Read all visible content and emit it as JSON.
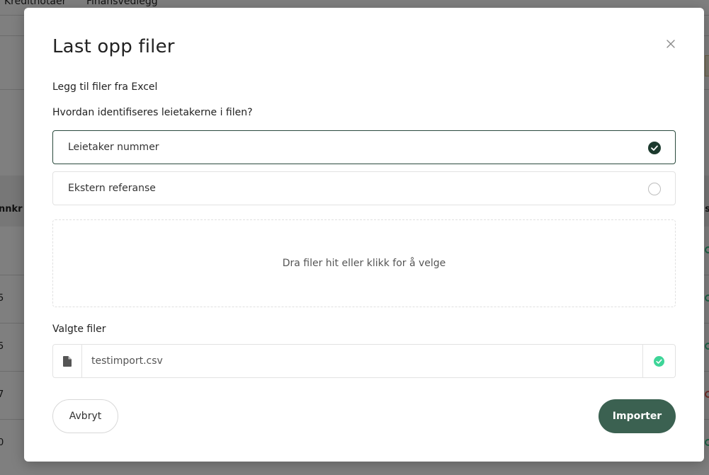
{
  "background": {
    "tabs": [
      "Kreditnotaer",
      "Finansvedlegg"
    ],
    "column_head_left": "nnkr",
    "column_head_right": "s",
    "row_values": [
      "5",
      "5",
      "7",
      "0"
    ]
  },
  "modal": {
    "title": "Last opp filer",
    "subtitle": "Legg til filer fra Excel",
    "question": "Hvordan identifiseres leietakerne i filen?",
    "options": [
      {
        "label": "Leietaker nummer",
        "selected": true
      },
      {
        "label": "Ekstern referanse",
        "selected": false
      }
    ],
    "dropzone_text": "Dra filer hit eller klikk for å velge",
    "selected_files_label": "Valgte filer",
    "files": [
      {
        "name": "testimport.csv",
        "status": "ok"
      }
    ],
    "cancel_label": "Avbryt",
    "import_label": "Importer"
  },
  "colors": {
    "accent": "#3b6151",
    "selected_border": "#2a4a3d",
    "radio_checked": "#1c3a2e",
    "success": "#3ed598"
  },
  "icons": {
    "close": "close-icon",
    "radio_checked": "check-circle-icon",
    "radio_unchecked": "radio-empty-icon",
    "file": "file-icon",
    "file_status": "check-circle-icon"
  }
}
